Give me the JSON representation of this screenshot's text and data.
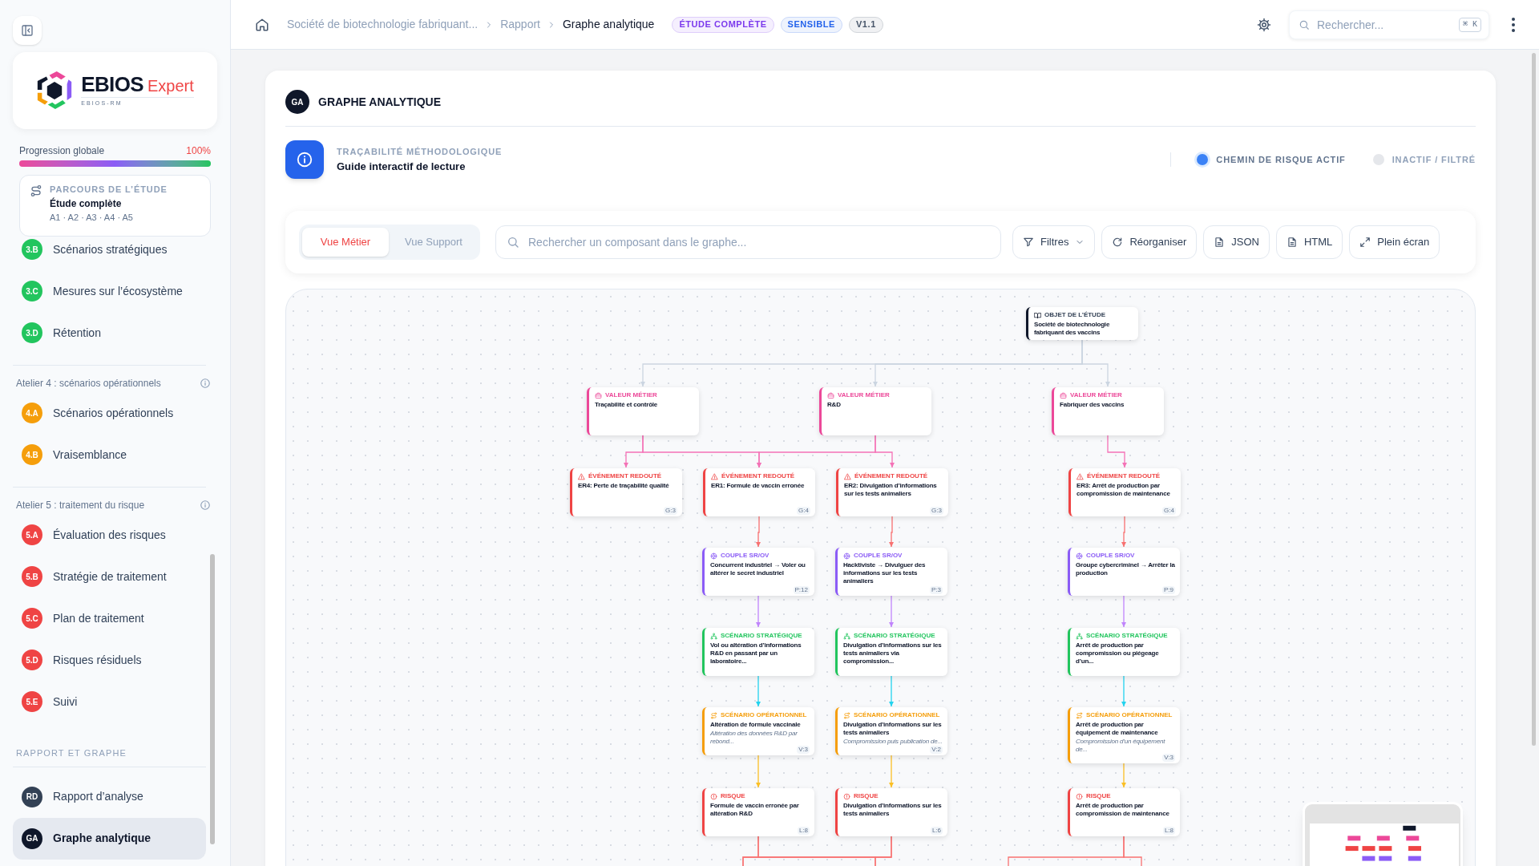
{
  "sidebar": {
    "logo": {
      "name": "EBIOS",
      "accent": "Expert",
      "tagline": "EBIOS-RM"
    },
    "progress": {
      "label": "Progression globale",
      "value": "100%",
      "level": 1
    },
    "journey": {
      "title": "PARCOURS DE L’ÉTUDE",
      "name": "Étude complète",
      "steps": "A1 · A2 · A3 · A4 · A5"
    },
    "sections": [
      {
        "kind": "continued",
        "items": [
          {
            "code": "3.B",
            "label": "Scénarios stratégiques",
            "color": "#22c55e",
            "selected": false
          },
          {
            "code": "3.C",
            "label": "Mesures sur l’écosystème",
            "color": "#22c55e",
            "selected": false
          },
          {
            "code": "3.D",
            "label": "Rétention",
            "color": "#22c55e",
            "selected": false
          }
        ]
      },
      {
        "kind": "workshop",
        "title": "Atelier 4 : scénarios opérationnels",
        "items": [
          {
            "code": "4.A",
            "label": "Scénarios opérationnels",
            "color": "#f59e0b",
            "selected": false
          },
          {
            "code": "4.B",
            "label": "Vraisemblance",
            "color": "#f59e0b",
            "selected": false
          }
        ]
      },
      {
        "kind": "workshop",
        "title": "Atelier 5 : traitement du risque",
        "items": [
          {
            "code": "5.A",
            "label": "Évaluation des risques",
            "color": "#ef4444",
            "selected": false
          },
          {
            "code": "5.B",
            "label": "Stratégie de traitement",
            "color": "#ef4444",
            "selected": false
          },
          {
            "code": "5.C",
            "label": "Plan de traitement",
            "color": "#ef4444",
            "selected": false
          },
          {
            "code": "5.D",
            "label": "Risques résiduels",
            "color": "#ef4444",
            "selected": false
          },
          {
            "code": "5.E",
            "label": "Suivi",
            "color": "#ef4444",
            "selected": false
          }
        ]
      },
      {
        "kind": "caps",
        "title": "RAPPORT ET GRAPHE",
        "items": [
          {
            "code": "RD",
            "label": "Rapport d’analyse",
            "color": "#334155",
            "selected": false
          },
          {
            "code": "GA",
            "label": "Graphe analytique",
            "color": "#0f172a",
            "selected": true
          }
        ]
      }
    ]
  },
  "header": {
    "breadcrumb": [
      {
        "label": "Société de biotechnologie fabriquant...",
        "current": false
      },
      {
        "label": "Rapport",
        "current": false
      },
      {
        "label": "Graphe analytique",
        "current": true
      }
    ],
    "badges": [
      {
        "label": "ÉTUDE COMPLÈTE",
        "color": "#7c3aed"
      },
      {
        "label": "SENSIBLE",
        "color": "#2563eb"
      },
      {
        "label": "V1.1",
        "color": "#475569"
      }
    ],
    "search": {
      "placeholder": "Rechercher...",
      "shortcut": "⌘ K"
    }
  },
  "card": {
    "initials": "GA",
    "title": "GRAPHE ANALYTIQUE",
    "guide": {
      "eyebrow": "TRAÇABILITÉ MÉTHODOLOGIQUE",
      "title": "Guide interactif de lecture"
    },
    "legend": [
      {
        "label": "CHEMIN DE RISQUE ACTIF",
        "color": "#3b82f6",
        "kind": "active"
      },
      {
        "label": "INACTIF / FILTRÉ",
        "color": "#e5e7eb",
        "kind": "inactive"
      }
    ],
    "views": [
      {
        "label": "Vue Métier",
        "selected": true
      },
      {
        "label": "Vue Support",
        "selected": false
      }
    ],
    "search": {
      "placeholder": "Rechercher un composant dans le graphe..."
    },
    "actions": [
      {
        "label": "Filtres",
        "kind": "filter"
      },
      {
        "label": "Réorganiser",
        "kind": "reorganize"
      },
      {
        "label": "JSON",
        "kind": "file"
      },
      {
        "label": "HTML",
        "kind": "file"
      },
      {
        "label": "Plein écran",
        "kind": "fullscreen"
      }
    ]
  },
  "graph": {
    "levels": [
      {
        "kind": "study",
        "nodes": [
          {
            "label": "OBJET DE L’ÉTUDE",
            "title": "Société de biotechnologie fabriquant des vaccins"
          }
        ]
      },
      {
        "kind": "value",
        "nodes": [
          {
            "label": "VALEUR MÉTIER",
            "title": "Traçabilité et contrôle"
          },
          {
            "label": "VALEUR MÉTIER",
            "title": "R&D"
          },
          {
            "label": "VALEUR MÉTIER",
            "title": "Fabriquer des vaccins"
          }
        ]
      },
      {
        "kind": "feared",
        "nodes": [
          {
            "label": "ÉVÉNEMENT REDOUTÉ",
            "title": "ER4: Perte de traçabilité qualité",
            "badge": "G:3"
          },
          {
            "label": "ÉVÉNEMENT REDOUTÉ",
            "title": "ER1: Formule de vaccin erronée",
            "badge": "G:4"
          },
          {
            "label": "ÉVÉNEMENT REDOUTÉ",
            "title": "ER2: Divulgation d’informations sur les tests animaliers",
            "badge": "G:3"
          },
          {
            "label": "ÉVÉNEMENT REDOUTÉ",
            "title": "ER3: Arrêt de production par compromission de maintenance",
            "badge": "G:4"
          }
        ]
      },
      {
        "kind": "couple",
        "nodes": [
          {
            "label": "COUPLE SR/OV",
            "title": "Concurrent industriel → Voler ou altérer le secret industriel",
            "badge": "P:12"
          },
          {
            "label": "COUPLE SR/OV",
            "title": "Hacktiviste → Divulguer des informations sur les tests animaliers",
            "badge": "P:3"
          },
          {
            "label": "COUPLE SR/OV",
            "title": "Groupe cybercriminel → Arrêter la production",
            "badge": "P:9"
          }
        ]
      },
      {
        "kind": "strategic",
        "nodes": [
          {
            "label": "SCÉNARIO STRATÉGIQUE",
            "title": "Vol ou altération d’informations R&D en passant par un laboratoire..."
          },
          {
            "label": "SCÉNARIO STRATÉGIQUE",
            "title": "Divulgation d’informations sur les tests animaliers via compromission..."
          },
          {
            "label": "SCÉNARIO STRATÉGIQUE",
            "title": "Arrêt de production par compromission ou piégeage d’un..."
          }
        ]
      },
      {
        "kind": "operational",
        "nodes": [
          {
            "label": "SCÉNARIO OPÉRATIONNEL",
            "title": "Altération de formule vaccinale",
            "subtitle": "Altération des données R&D par rebond...",
            "badge": "V:3"
          },
          {
            "label": "SCÉNARIO OPÉRATIONNEL",
            "title": "Divulgation d’informations sur les tests animaliers",
            "subtitle": "Compromission puis publication de...",
            "badge": "V:2"
          },
          {
            "label": "SCÉNARIO OPÉRATIONNEL",
            "title": "Arrêt de production par équipement de maintenance",
            "subtitle": "Compromission d’un équipement de...",
            "badge": "V:3"
          }
        ]
      },
      {
        "kind": "risk",
        "nodes": [
          {
            "label": "RISQUE",
            "title": "Formule de vaccin erronée par altération R&D",
            "badge": "L:8"
          },
          {
            "label": "RISQUE",
            "title": "Divulgation d’informations sur les tests animaliers",
            "badge": "L:6"
          },
          {
            "label": "RISQUE",
            "title": "Arrêt de production par compromission de maintenance",
            "badge": "L:8"
          }
        ]
      }
    ]
  }
}
